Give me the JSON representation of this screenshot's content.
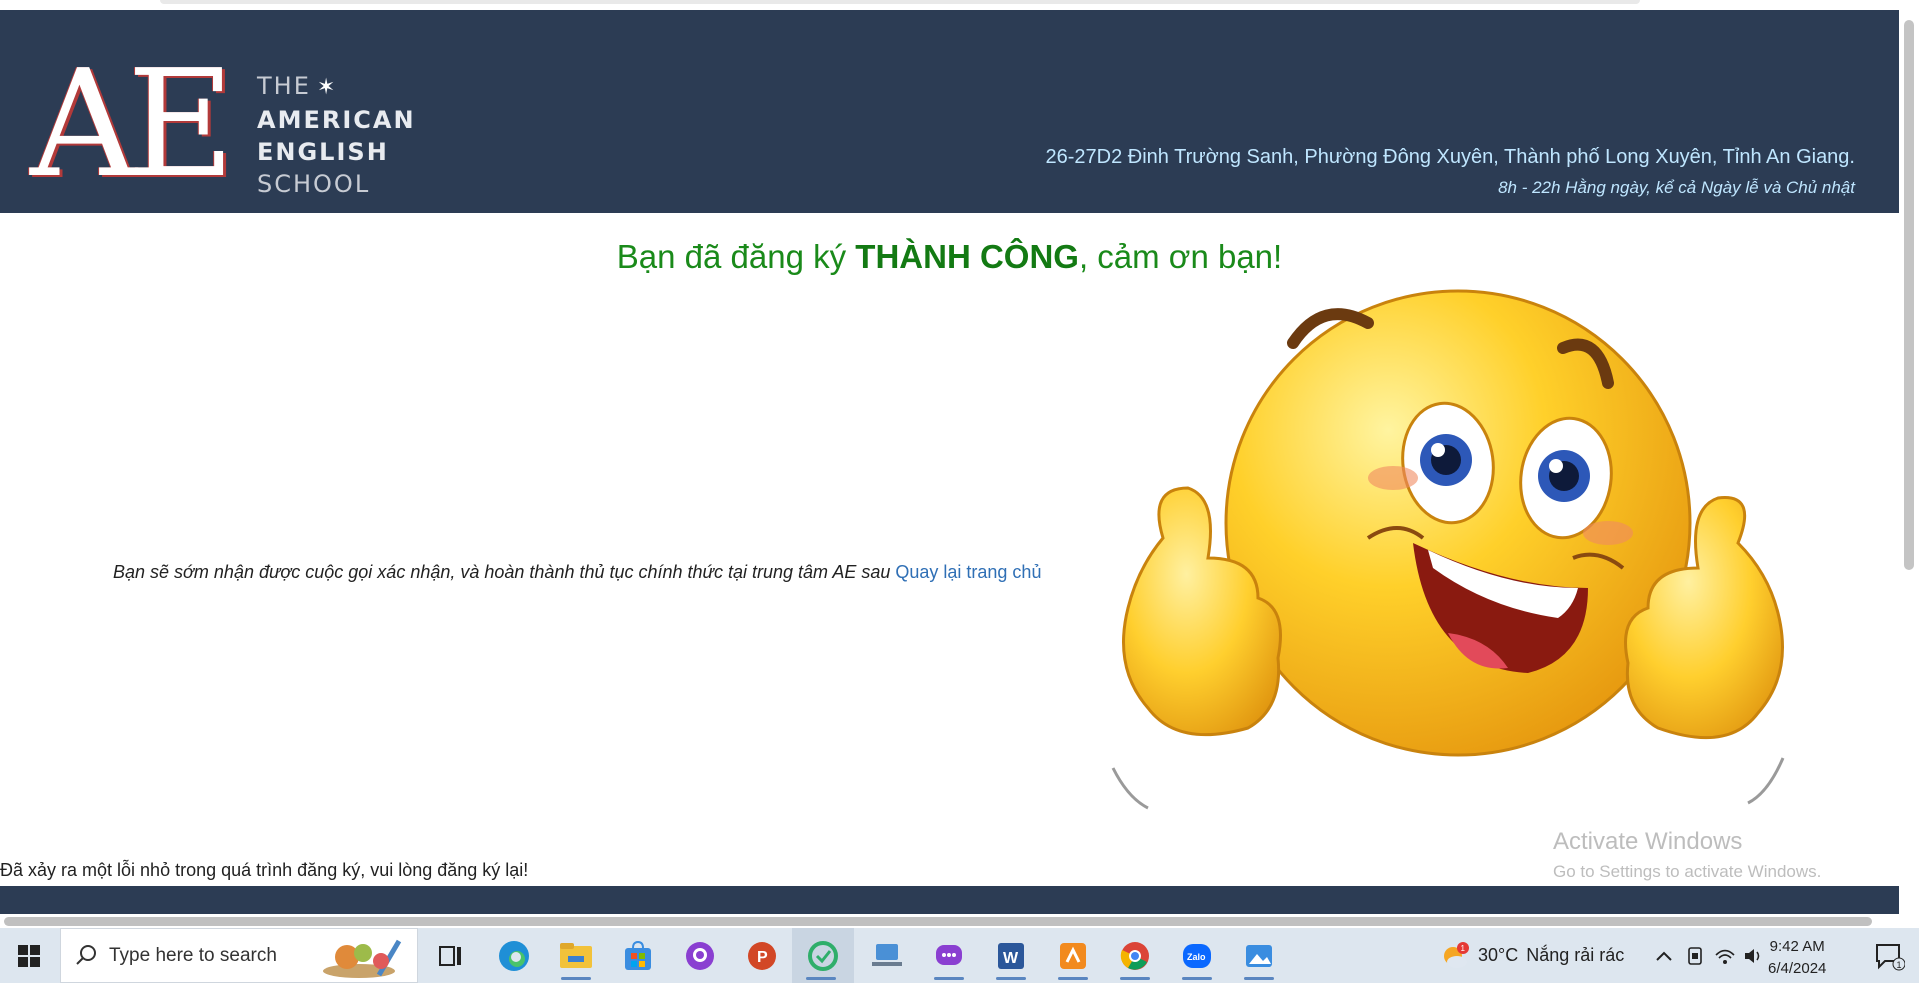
{
  "header": {
    "logo": {
      "initials": "AE",
      "line1": "THE",
      "line2": "AMERICAN",
      "line3": "ENGLISH",
      "line4": "SCHOOL"
    },
    "address": "26-27D2 Đinh Trường Sanh, Phường Đông Xuyên, Thành phố Long Xuyên, Tỉnh An Giang.",
    "hours": "8h - 22h Hằng ngày, kể cả Ngày lễ và Chủ nhật"
  },
  "main": {
    "success_prefix": "Bạn đã đăng ký ",
    "success_bold": "THÀNH CÔNG",
    "success_suffix": ", cảm ơn bạn!",
    "message": "Bạn sẽ sớm nhận được cuộc gọi xác nhận, và hoàn thành thủ tục chính thức tại trung tâm AE sau ",
    "home_link": "Quay lại trang chủ",
    "error": "Đã xảy ra một lỗi nhỏ trong quá trình đăng ký, vui lòng đăng ký lại!"
  },
  "watermark": {
    "title": "Activate Windows",
    "subtitle": "Go to Settings to activate Windows."
  },
  "taskbar": {
    "search_placeholder": "Type here to search",
    "apps": [
      "start-icon",
      "task-view-icon",
      "edge-icon",
      "file-explorer-icon",
      "store-icon",
      "github-icon",
      "powerpoint-icon",
      "snipping-icon",
      "cloud-icon",
      "chat-app-icon",
      "word-icon",
      "pdf-icon",
      "chrome-icon",
      "zalo-icon",
      "photos-icon"
    ],
    "zalo_label": "Zalo",
    "weather_badge": "1",
    "weather_temp": "30°C",
    "weather_desc": "Nắng rải rác",
    "time": "9:42 AM",
    "date": "6/4/2024",
    "notification_count": "1"
  },
  "colors": {
    "header_bg": "#2c3c54",
    "success_green": "#1a8a1a",
    "link_blue": "#2f6fb5",
    "address_text": "#bfe6ff"
  }
}
